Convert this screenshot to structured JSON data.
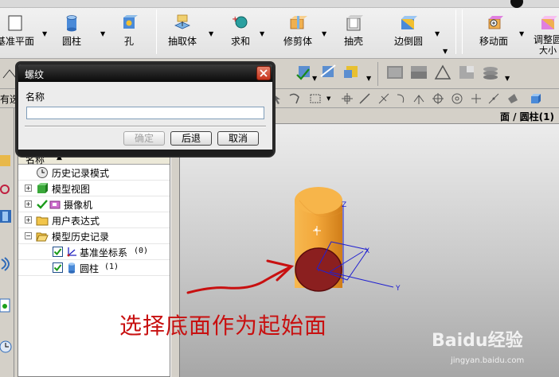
{
  "ribbon": {
    "items": [
      {
        "label": "基准平面"
      },
      {
        "label": "圆柱"
      },
      {
        "label": "孔"
      },
      {
        "label": "抽取体"
      },
      {
        "label": "求和"
      },
      {
        "label": "修剪体"
      },
      {
        "label": "抽壳"
      },
      {
        "label": "边倒圆"
      },
      {
        "label": "移动面"
      },
      {
        "label": "调整圆"
      },
      {
        "label": "大小"
      }
    ]
  },
  "toolbar3": {
    "left_label": "有选"
  },
  "breadcrumb": {
    "text": "面 / 圆柱(1)"
  },
  "dialog": {
    "title": "螺纹",
    "name_label": "名称",
    "name_value": "",
    "ok_label": "确定",
    "back_label": "后退",
    "cancel_label": "取消"
  },
  "navigator": {
    "header": "名称",
    "sort_indicator": "▲",
    "rows": [
      {
        "label": "历史记录模式",
        "icon": "clock-icon"
      },
      {
        "label": "模型视图",
        "icon": "views-icon"
      },
      {
        "label": "摄像机",
        "icon": "camera-icon"
      },
      {
        "label": "用户表达式",
        "icon": "folder-icon"
      },
      {
        "label": "模型历史记录",
        "icon": "folder-open-icon"
      },
      {
        "label": "基准坐标系",
        "icon": "datum-csys-icon",
        "count": "(0)"
      },
      {
        "label": "圆柱",
        "icon": "cylinder-icon",
        "count": "(1)"
      }
    ]
  },
  "viewport": {
    "axis_x": "X",
    "axis_y": "Y",
    "axis_z": "Z"
  },
  "annotation": {
    "text": "选择底面作为起始面"
  },
  "watermark": {
    "logo": "Baidu经验",
    "url": "jingyan.baidu.com"
  },
  "colors": {
    "annotation_red": "#c81010",
    "cylinder_orange": "#f3a83b",
    "selected_face": "#8b1f1f",
    "csys_blue": "#2020d0"
  }
}
